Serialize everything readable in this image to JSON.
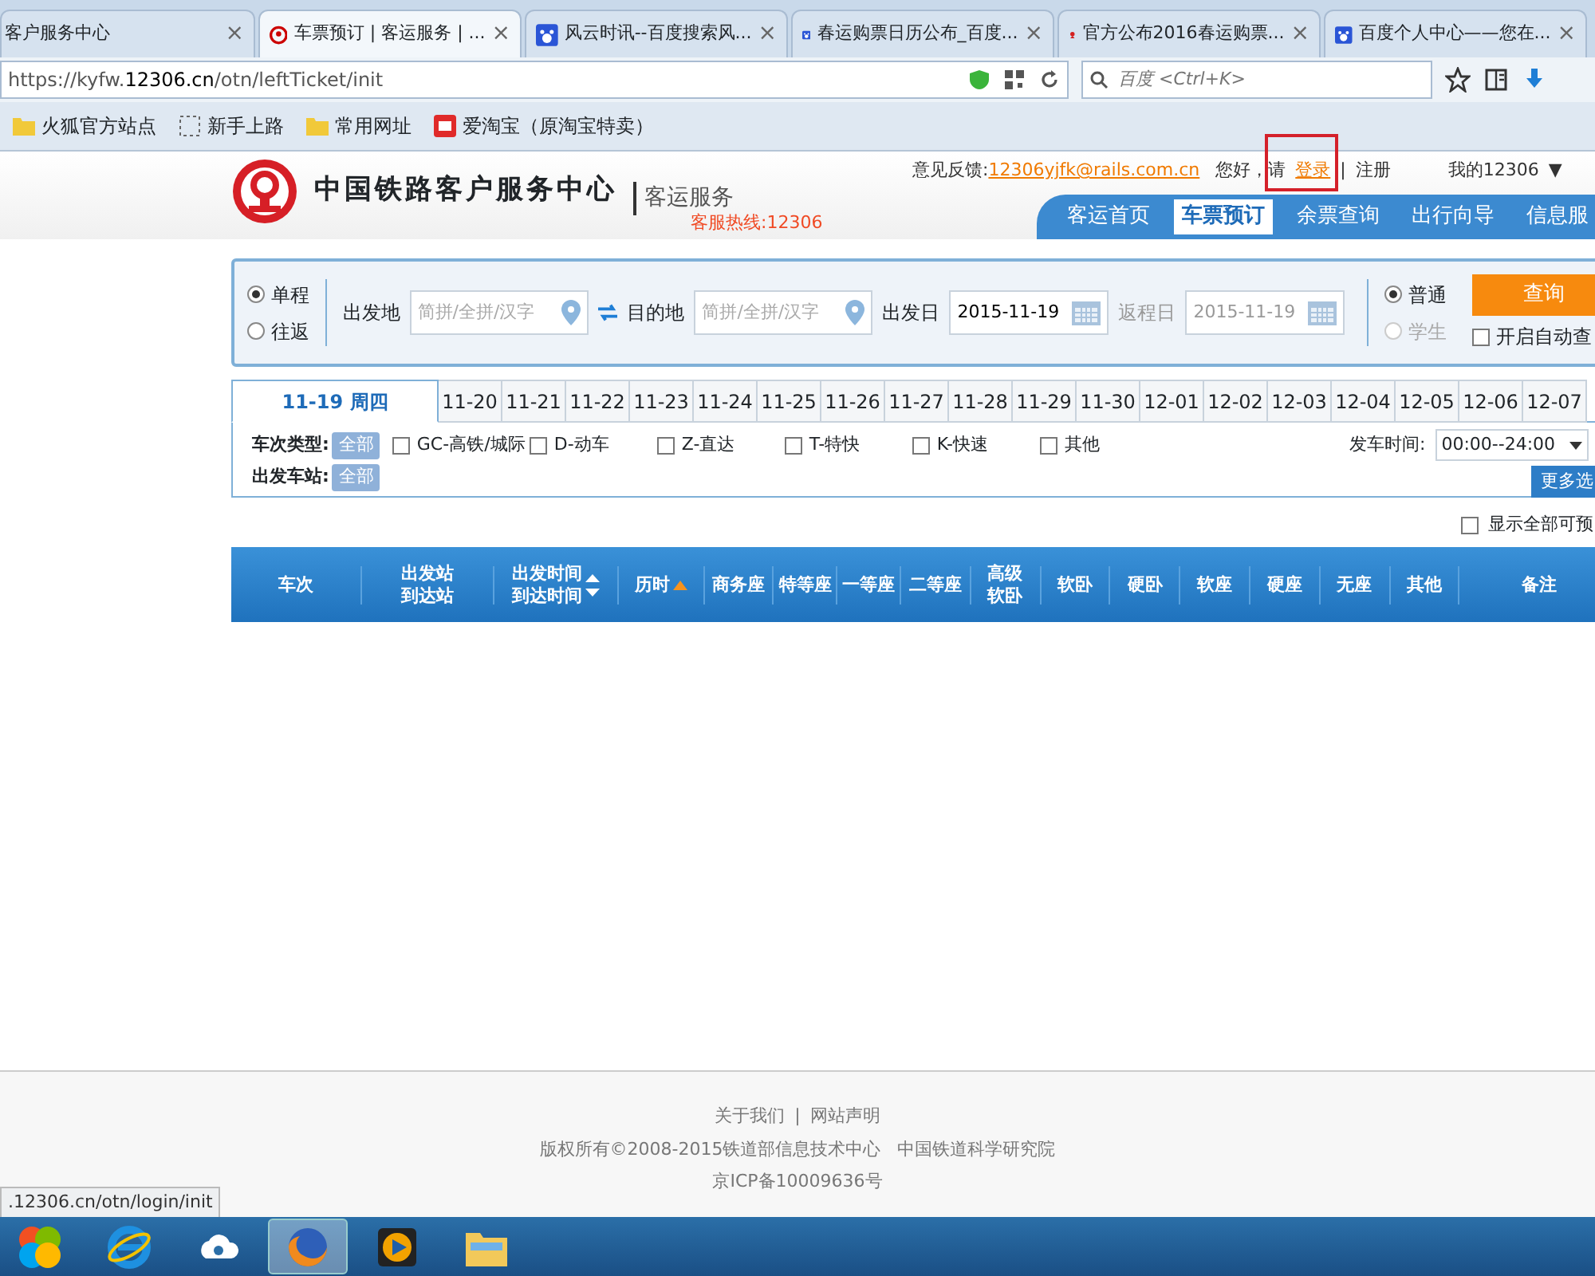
{
  "browser_tabs": [
    {
      "title": "客户服务中心",
      "selected": false,
      "kind": "plain"
    },
    {
      "title": "车票预订 | 客运服务 | ...",
      "selected": true,
      "kind": "rail"
    },
    {
      "title": "风云时讯--百度搜索风...",
      "selected": false,
      "kind": "paw"
    },
    {
      "title": "春运购票日历公布_百度...",
      "selected": false,
      "kind": "paw"
    },
    {
      "title": "官方公布2016春运购票...",
      "selected": false,
      "kind": "news"
    },
    {
      "title": "百度个人中心——您在...",
      "selected": false,
      "kind": "paw"
    }
  ],
  "tab_close": "×",
  "address": {
    "prefix": "https://kyfw.",
    "domain": "12306.cn",
    "path": "/otn/leftTicket/init"
  },
  "search_box": {
    "placeholder": "百度 <Ctrl+K>"
  },
  "bookmarks": [
    {
      "label": "火狐官方站点",
      "kind": "folder"
    },
    {
      "label": "新手上路",
      "kind": "dashed"
    },
    {
      "label": "常用网址",
      "kind": "folder"
    },
    {
      "label": "爱淘宝（原淘宝特卖）",
      "kind": "taobao"
    }
  ],
  "site": {
    "title": "中国铁路客户服务中心",
    "subtitle": "客运服务",
    "hotline": "客服热线:12306",
    "feedback_label": "意见反馈:",
    "feedback_email": "12306yjfk@rails.com.cn",
    "greeting": "您好，请",
    "login": "登录",
    "separator": "|",
    "register": "注册",
    "my": "我的12306",
    "my_caret": "▼",
    "nav": [
      {
        "label": "客运首页",
        "selected": false
      },
      {
        "label": "车票预订",
        "selected": true
      },
      {
        "label": "余票查询",
        "selected": false
      },
      {
        "label": "出行向导",
        "selected": false
      },
      {
        "label": "信息服",
        "selected": false
      }
    ]
  },
  "query": {
    "trip": [
      {
        "label": "单程",
        "selected": true
      },
      {
        "label": "往返",
        "selected": false
      }
    ],
    "from_label": "出发地",
    "from_placeholder": "简拼/全拼/汉字",
    "to_label": "目的地",
    "to_placeholder": "简拼/全拼/汉字",
    "date_label": "出发日",
    "date": "2015-11-19",
    "return_label": "返程日",
    "return_date": "2015-11-19",
    "ticket_type": [
      {
        "label": "普通",
        "selected": true,
        "disabled": false
      },
      {
        "label": "学生",
        "selected": false,
        "disabled": true
      }
    ],
    "search_button": "查询",
    "auto_query": {
      "label": "开启自动查",
      "checked": false
    }
  },
  "dates": [
    {
      "label": "11-19 周四",
      "selected": true
    },
    {
      "label": "11-20",
      "selected": false
    },
    {
      "label": "11-21",
      "selected": false
    },
    {
      "label": "11-22",
      "selected": false
    },
    {
      "label": "11-23",
      "selected": false
    },
    {
      "label": "11-24",
      "selected": false
    },
    {
      "label": "11-25",
      "selected": false
    },
    {
      "label": "11-26",
      "selected": false
    },
    {
      "label": "11-27",
      "selected": false
    },
    {
      "label": "11-28",
      "selected": false
    },
    {
      "label": "11-29",
      "selected": false
    },
    {
      "label": "11-30",
      "selected": false
    },
    {
      "label": "12-01",
      "selected": false
    },
    {
      "label": "12-02",
      "selected": false
    },
    {
      "label": "12-03",
      "selected": false
    },
    {
      "label": "12-04",
      "selected": false
    },
    {
      "label": "12-05",
      "selected": false
    },
    {
      "label": "12-06",
      "selected": false
    },
    {
      "label": "12-07",
      "selected": false
    }
  ],
  "filters": {
    "type_label": "车次类型:",
    "all": "全部",
    "types": [
      {
        "label": "GC-高铁/城际",
        "checked": false
      },
      {
        "label": "D-动车",
        "checked": false
      },
      {
        "label": "Z-直达",
        "checked": false
      },
      {
        "label": "T-特快",
        "checked": false
      },
      {
        "label": "K-快速",
        "checked": false
      },
      {
        "label": "其他",
        "checked": false
      }
    ],
    "time_label": "发车时间:",
    "time_value": "00:00--24:00",
    "station_label": "出发车站:",
    "station_all": "全部",
    "more": "更多选"
  },
  "show_all": {
    "label": "显示全部可预",
    "checked": false
  },
  "table": {
    "columns": [
      {
        "lines": [
          "车次"
        ],
        "kind": "plain"
      },
      {
        "lines": [
          "出发站",
          "到达站"
        ],
        "kind": "plain"
      },
      {
        "lines": [
          "出发时间",
          "到达时间"
        ],
        "kind": "sortable"
      },
      {
        "lines": [
          "历时"
        ],
        "kind": "sorted"
      },
      {
        "lines": [
          "商务座"
        ],
        "kind": "plain"
      },
      {
        "lines": [
          "特等座"
        ],
        "kind": "plain"
      },
      {
        "lines": [
          "一等座"
        ],
        "kind": "plain"
      },
      {
        "lines": [
          "二等座"
        ],
        "kind": "plain"
      },
      {
        "lines": [
          "高级",
          "软卧"
        ],
        "kind": "plain"
      },
      {
        "lines": [
          "软卧"
        ],
        "kind": "plain"
      },
      {
        "lines": [
          "硬卧"
        ],
        "kind": "plain"
      },
      {
        "lines": [
          "软座"
        ],
        "kind": "plain"
      },
      {
        "lines": [
          "硬座"
        ],
        "kind": "plain"
      },
      {
        "lines": [
          "无座"
        ],
        "kind": "plain"
      },
      {
        "lines": [
          "其他"
        ],
        "kind": "plain"
      },
      {
        "lines": [
          "备注"
        ],
        "kind": "plain"
      }
    ]
  },
  "footer": {
    "links": [
      "关于我们",
      "网站声明"
    ],
    "link_sep": "|",
    "copyright": "版权所有©2008-2015铁道部信息技术中心   中国铁道科学研究院",
    "icp": "京ICP备10009636号"
  },
  "status_url": ".12306.cn/otn/login/init",
  "taskbar": [
    {
      "kind": "start",
      "active": false
    },
    {
      "kind": "ie",
      "active": false
    },
    {
      "kind": "cloud",
      "active": false
    },
    {
      "kind": "firefox",
      "active": true
    },
    {
      "kind": "media",
      "active": false
    },
    {
      "kind": "files",
      "active": false
    }
  ]
}
